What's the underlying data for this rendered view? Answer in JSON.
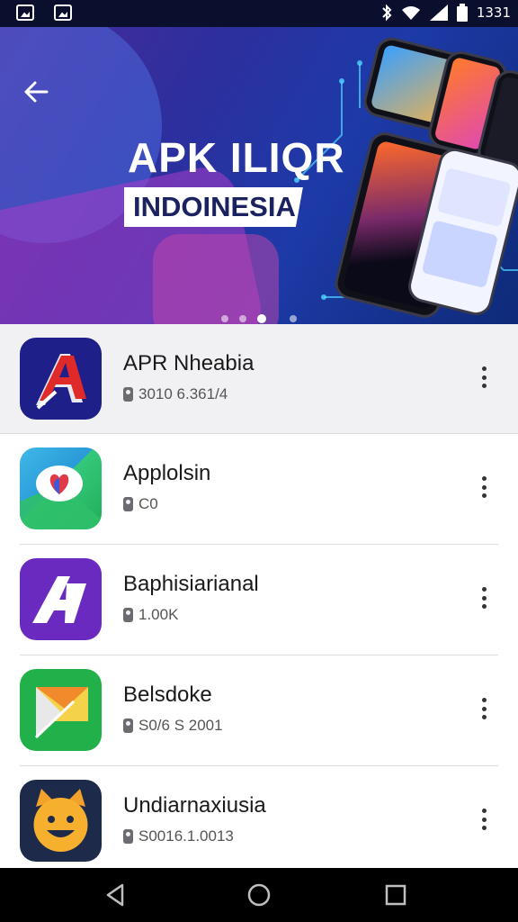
{
  "status_bar": {
    "time": "1331",
    "icons": [
      "image-icon",
      "cloud-icon",
      "bluetooth-icon",
      "wifi-icon",
      "signal-icon",
      "battery-icon"
    ]
  },
  "banner": {
    "title": "APK ILIQR",
    "subtitle": "INDOINESIA",
    "carousel_dots": 4,
    "active_dot": 2
  },
  "apps": [
    {
      "name": "APR Nheabia",
      "size": "3010 6.361/4",
      "icon": "red-a-logo-icon"
    },
    {
      "name": "Applolsin",
      "size": "C0",
      "icon": "heart-map-icon"
    },
    {
      "name": "Baphisiarianal",
      "size": "1.00K",
      "icon": "purple-a-logo-icon"
    },
    {
      "name": "Belsdoke",
      "size": "S0/6 S 2001",
      "icon": "green-envelope-icon"
    },
    {
      "name": "Undiarnaxiusia",
      "size": "S0016.1.0013",
      "icon": "cat-face-icon"
    }
  ],
  "colors": {
    "banner_bg": "#2c2f9e",
    "accent": "#ffffff",
    "text": "#1a1a1a"
  }
}
